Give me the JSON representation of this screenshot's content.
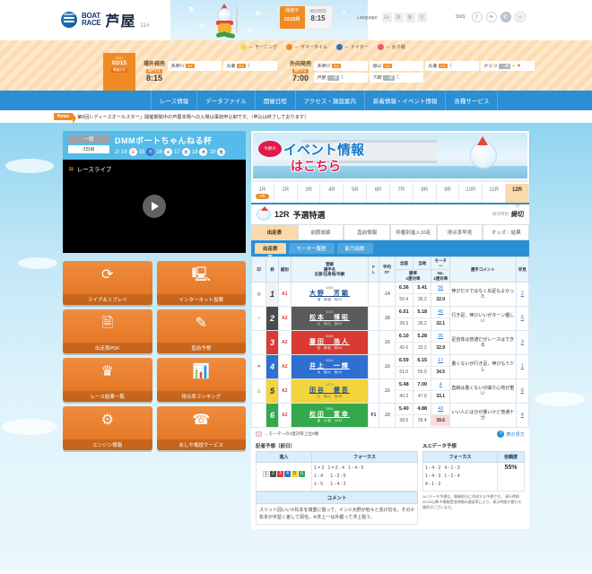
{
  "header": {
    "logo_line1": "BOAT",
    "logo_line2": "RACE",
    "venue_name": "芦屋",
    "venue_no": "21#",
    "status_label": "開催中",
    "status_date": "02/15",
    "status_date_suffix": "月",
    "deadline_label": "締切時刻",
    "deadline_time": "8:15",
    "language_label": "Language:",
    "languages": [
      "En",
      "简",
      "繁",
      "한"
    ],
    "sns_label": "SNS:",
    "sns": [
      "facebook-icon",
      "twitter-icon",
      "line-icon",
      "instagram-icon"
    ],
    "legend": [
      {
        "icon": "morning-icon",
        "label": "モーニング"
      },
      {
        "icon": "summertime-icon",
        "label": "サマータイム"
      },
      {
        "icon": "nighter-icon",
        "label": "ナイター"
      },
      {
        "icon": "ladies-icon",
        "label": "女子戦"
      }
    ]
  },
  "sale_band": {
    "date_year": "2021",
    "date_md": "02/15",
    "date_badge": "開催初日",
    "jogai": {
      "title": "場外発売",
      "badge": "開門予定",
      "time": "8:15"
    },
    "gaibu": {
      "title": "外向発売",
      "badge": "開門予定",
      "time": "7:00"
    },
    "jogai_venues": [
      {
        "name": "多摩川",
        "grade": "G1",
        "gray": false,
        "icons": []
      },
      {
        "name": "丸亀",
        "grade": "G1",
        "gray": false,
        "icons": [
          "nighter-icon"
        ]
      }
    ],
    "gaibu_venues": [
      {
        "name": "多摩川",
        "grade": "G1",
        "gray": false,
        "icons": []
      },
      {
        "name": "徳山",
        "grade": "G1",
        "gray": false,
        "icons": []
      },
      {
        "name": "丸亀",
        "grade": "G1",
        "gray": false,
        "icons": [
          "nighter-icon"
        ]
      },
      {
        "name": "からつ",
        "grade": "一般",
        "gray": true,
        "icons": [
          "morning-icon",
          "ladies-icon"
        ]
      },
      {
        "name": "芦屋",
        "grade": "一般",
        "gray": true,
        "icons": [
          "nighter-icon"
        ]
      },
      {
        "name": "下関",
        "grade": "一般",
        "gray": true,
        "icons": [
          "nighter-icon"
        ]
      }
    ]
  },
  "global_nav": [
    "レース情報",
    "データファイル",
    "開催日程",
    "アクセス・施設案内",
    "新着情報・イベント情報",
    "各種サービス"
  ],
  "news": {
    "badge": "News",
    "text": "第5回レディースオールスター」開催期間中の芦屋本場への入場は事前申込制です。（申込は終了しております）"
  },
  "race_title": {
    "grade_badge": "一般",
    "day_badge": "2日目",
    "name": "DMMボートちゃんねる杯",
    "month": "2/",
    "days": [
      {
        "d": "14",
        "w": "日",
        "sel": false,
        "sun": true
      },
      {
        "d": "15",
        "w": "月",
        "sel": true,
        "sun": false
      },
      {
        "d": "16",
        "w": "火",
        "sel": false,
        "sun": false
      },
      {
        "d": "17",
        "w": "水",
        "sel": false,
        "sun": false
      },
      {
        "d": "18",
        "w": "木",
        "sel": false,
        "sun": false
      },
      {
        "d": "19",
        "w": "金",
        "sel": false,
        "sun": false
      }
    ]
  },
  "player": {
    "label": "レースライブ",
    "icon": "wifi-icon",
    "play_icon": "play-icon"
  },
  "buttons": [
    {
      "label": "ライブ＆リプレイ",
      "icon": "replay-icon"
    },
    {
      "label": "インターネット投票",
      "icon": "monitor-icon"
    },
    {
      "label": "出走表PDF",
      "icon": "pdf-icon"
    },
    {
      "label": "直前予想",
      "icon": "edit-doc-icon"
    },
    {
      "label": "レース結果一覧",
      "icon": "crown-icon"
    },
    {
      "label": "得点率ランキング",
      "icon": "bar-chart-icon"
    },
    {
      "label": "エンジン情報",
      "icon": "engine-icon"
    },
    {
      "label": "あしや電投サービス",
      "icon": "phone-icon"
    }
  ],
  "banner": {
    "bubble": "今節の",
    "line1": "イベント情報",
    "line2": "はこちら"
  },
  "race_tabs": {
    "items": [
      "1R",
      "2R",
      "3R",
      "4R",
      "5R",
      "6R",
      "7R",
      "8R",
      "9R",
      "10R",
      "11R",
      "12R"
    ],
    "active": "12R",
    "first_badge": "2枠"
  },
  "race_head": {
    "race_no": "12R",
    "race_name": "予選特選",
    "deadline_key": "締切時刻",
    "deadline_value": "締切"
  },
  "sub_tabs": {
    "items": [
      "出走表",
      "前節成績",
      "直前情報",
      "枠番別進入10走",
      "得点率早見",
      "オッズ・結果"
    ],
    "active": "出走表"
  },
  "blue_tabs": {
    "items": [
      "出走表",
      "モーター履歴",
      "能力指数"
    ],
    "active": "出走表"
  },
  "table": {
    "headers": {
      "mark": "印",
      "lane": "枠",
      "class": "級別",
      "name_l1": "登録",
      "name_l2": "選手名",
      "name_l3": "支部/出身地/年齢",
      "fl_l1": "F",
      "fl_l2": "L",
      "st_l1": "平均",
      "st_l2": "ST",
      "zenkoku": "全国",
      "touchi": "当地",
      "motor": "モーター",
      "rate_l1": "勝率",
      "rate_l2": "2連対率",
      "motor_l1": "No.",
      "motor_l2": "2連対率",
      "comment": "選手コメント",
      "hayami": "早見"
    },
    "rows": [
      {
        "mark": "◎",
        "lane": "1",
        "class": "A1",
        "reg": "4363",
        "name": "大野　芳顕",
        "meta": "福　岡/福　岡/25",
        "fl": "",
        "st": ".14",
        "zenkoku_top": "6.36",
        "zenkoku_bot": "50.4",
        "touchi_top": "5.41",
        "touchi_bot": "35.2",
        "motor_no": "56",
        "motor_rate": "32.0",
        "motor_hl": false,
        "comment": "伸びだけではなく出足もよかった",
        "hayami": "2"
      },
      {
        "mark": "○",
        "lane": "2",
        "class": "A2",
        "reg": "4000",
        "name": "松本　博昭",
        "meta": "広　島/広　島/44",
        "fl": "",
        "st": ".18",
        "zenkoku_top": "6.01",
        "zenkoku_bot": "39.3",
        "touchi_top": "5.18",
        "touchi_bot": "35.2",
        "motor_no": "45",
        "motor_rate": "32.1",
        "motor_hl": false,
        "comment": "行き足、伸びいいがターン優しい",
        "hayami": "5"
      },
      {
        "mark": "",
        "lane": "3",
        "class": "A2",
        "reg": "4515",
        "name": "藤田　浩人",
        "meta": "佐　賀/佐　賀/34",
        "fl": "",
        "st": ".16",
        "zenkoku_top": "6.10",
        "zenkoku_bot": "42.6",
        "touchi_top": "5.28",
        "touchi_bot": "33.3",
        "motor_no": "35",
        "motor_rate": "32.9",
        "motor_hl": false,
        "comment": "足自体は普通だがレースはできる",
        "hayami": "3"
      },
      {
        "mark": "✕",
        "lane": "4",
        "class": "A2",
        "reg": "4826",
        "name": "井上　一輝",
        "meta": "大　阪/大　阪/26",
        "fl": "",
        "st": ".16",
        "zenkoku_top": "6.59",
        "zenkoku_bot": "51.0",
        "touchi_top": "6.15",
        "touchi_bot": "55.0",
        "motor_no": "17",
        "motor_rate": "34.5",
        "motor_hl": false,
        "comment": "悪くないが行き足、伸びもう少し",
        "hayami": "1"
      },
      {
        "mark": "△",
        "lane": "5",
        "class": "A2",
        "reg": "4173",
        "name": "田谷　健吾",
        "meta": "広　島/広　島/38",
        "fl": "",
        "st": ".16",
        "zenkoku_top": "5.48",
        "zenkoku_bot": "40.3",
        "touchi_top": "7.00",
        "touchi_bot": "47.0",
        "motor_no": "4",
        "motor_rate": "33.1",
        "motor_hl": false,
        "comment": "直線は悪くないが曲り心地が重い",
        "hayami": "8"
      },
      {
        "mark": "",
        "lane": "6",
        "class": "A2",
        "reg": "2901",
        "name": "松田　富幸",
        "meta": "香　川/香　川/43",
        "fl": "F1",
        "st": ".18",
        "zenkoku_top": "5.40",
        "zenkoku_bot": "39.5",
        "touchi_top": "4.88",
        "touchi_bot": "29.4",
        "motor_no": "43",
        "motor_rate": "39.6",
        "motor_hl": true,
        "comment": "いい人には分が悪いけど普通十分",
        "hayami": "4"
      }
    ],
    "note": "…モーターの2連対率上位5機",
    "help": "表の見方"
  },
  "prediction": {
    "reporter_title": "記者予想（前日）",
    "reporter_headers": [
      "進入",
      "フォーカス"
    ],
    "shinnyu": [
      "1",
      "2",
      "3",
      "4",
      "5",
      "6"
    ],
    "focus_rows": [
      [
        "1 = 2",
        "1 = 2 - 4",
        "1 - 4 - 5"
      ],
      [
        "1 - 4",
        "1 - 2 - 5",
        ""
      ],
      [
        "1 - 5",
        "1 - 4 - 2",
        ""
      ]
    ],
    "comment_header": "コメント",
    "comment_text": "スリット回いい②松本を慎重に狙って、イン①大野が他々と逃げ切る。その②松本が手堅く差して頭也。④井上一は外握って浮上狙う。",
    "jlc_title": "JLCデータ予想",
    "jlc_headers": [
      "フォーカス",
      "信頼度"
    ],
    "jlc_focus_rows": [
      [
        "1 - 4 - 2",
        "4 - 1 - 3"
      ],
      [
        "1 - 4 - 3",
        "1 - 2 - 4"
      ],
      [
        "4 - 1 - 2",
        ""
      ]
    ],
    "jlc_confidence": "55%",
    "jlc_note": "JLCデータ予想は、開催前日に作成する予想です。\n発行時刻20:00以降\n※情報受信時間の遅延等により、表示時間が遅れる場合がございます。"
  }
}
